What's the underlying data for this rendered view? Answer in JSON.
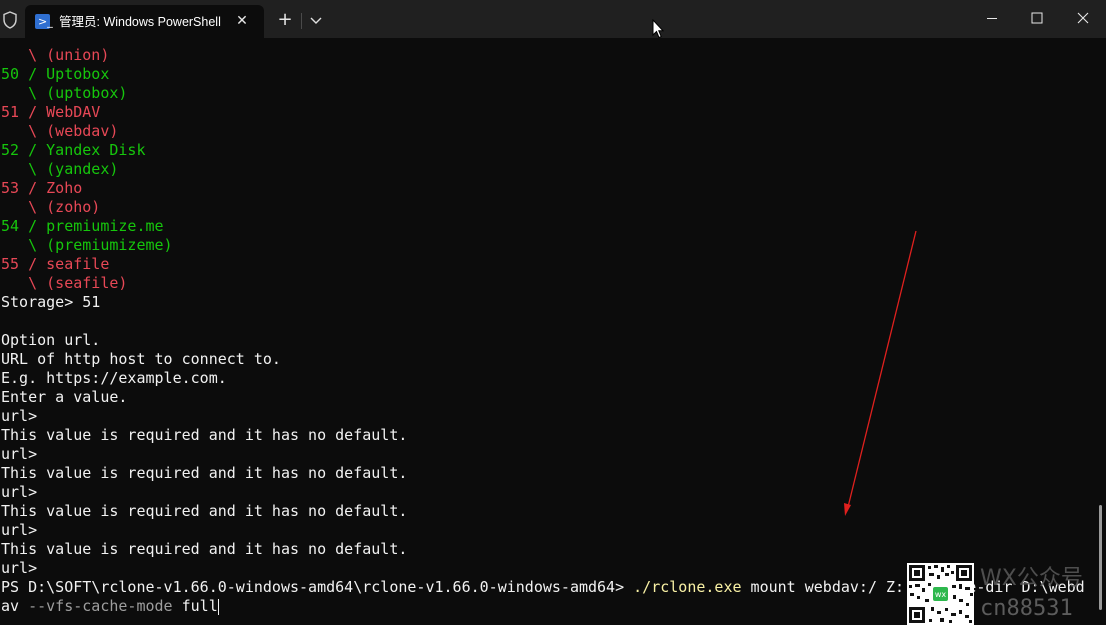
{
  "window": {
    "tab_title": "管理员: Windows PowerShell",
    "tab_close": "✕",
    "new_tab": "+",
    "icons": [
      "shield-icon",
      "powershell-icon",
      "close-icon",
      "plus-icon",
      "chevron-down-icon",
      "minimize-icon",
      "maximize-icon",
      "close-window-icon"
    ]
  },
  "terminal": {
    "lines": [
      {
        "color": "red",
        "text": "   \\ (union)"
      },
      {
        "color": "green",
        "text": "50 / Uptobox"
      },
      {
        "color": "green",
        "text": "   \\ (uptobox)"
      },
      {
        "color": "red",
        "text": "51 / WebDAV"
      },
      {
        "color": "red",
        "text": "   \\ (webdav)"
      },
      {
        "color": "green",
        "text": "52 / Yandex Disk"
      },
      {
        "color": "green",
        "text": "   \\ (yandex)"
      },
      {
        "color": "red",
        "text": "53 / Zoho"
      },
      {
        "color": "red",
        "text": "   \\ (zoho)"
      },
      {
        "color": "green",
        "text": "54 / premiumize.me"
      },
      {
        "color": "green",
        "text": "   \\ (premiumizeme)"
      },
      {
        "color": "red",
        "text": "55 / seafile"
      },
      {
        "color": "red",
        "text": "   \\ (seafile)"
      },
      {
        "color": "white",
        "text": "Storage> 51"
      },
      {
        "color": "white",
        "text": ""
      },
      {
        "color": "white",
        "text": "Option url."
      },
      {
        "color": "white",
        "text": "URL of http host to connect to."
      },
      {
        "color": "white",
        "text": "E.g. https://example.com."
      },
      {
        "color": "white",
        "text": "Enter a value."
      },
      {
        "color": "white",
        "text": "url>"
      },
      {
        "color": "white",
        "text": "This value is required and it has no default."
      },
      {
        "color": "white",
        "text": "url>"
      },
      {
        "color": "white",
        "text": "This value is required and it has no default."
      },
      {
        "color": "white",
        "text": "url>"
      },
      {
        "color": "white",
        "text": "This value is required and it has no default."
      },
      {
        "color": "white",
        "text": "url>"
      },
      {
        "color": "white",
        "text": "This value is required and it has no default."
      },
      {
        "color": "white",
        "text": "url>"
      }
    ],
    "prompt": "PS D:\\SOFT\\rclone-v1.66.0-windows-amd64\\rclone-v1.66.0-windows-amd64> ",
    "command_exe": "./rclone.exe",
    "command_args": " mount webdav:/ Z: --cache-dir D:\\webd",
    "command_cont": "av",
    "command_flag": " --vfs-cache-mode",
    "command_value": " full"
  },
  "watermark": {
    "line1": "WX公众号",
    "line2": "cn88531"
  },
  "colors": {
    "background": "#0c0c0c",
    "titlebar": "#202020",
    "red": "#e74856",
    "green": "#16c60c",
    "white": "#f2f2f2",
    "yellow": "#f9f1a5",
    "annotation_arrow": "#e0201e"
  }
}
